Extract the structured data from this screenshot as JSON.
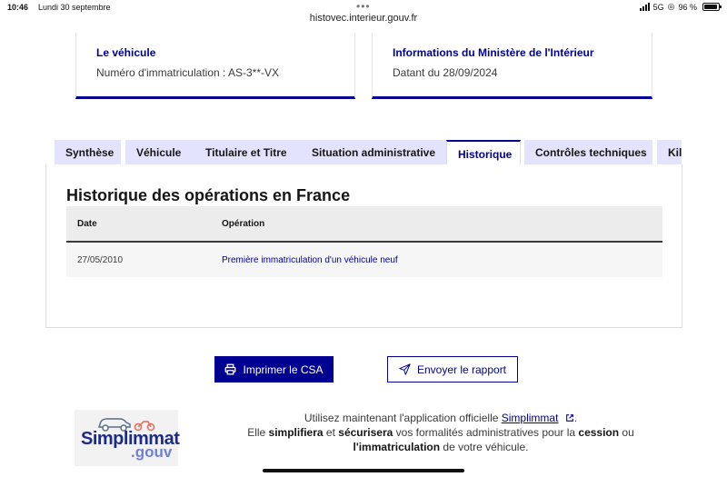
{
  "status": {
    "time": "10:46",
    "date": "Lundi 30 septembre",
    "network": "5G",
    "battery": "96 %",
    "battery_level": 0.96
  },
  "browser": {
    "url": "histovec.interieur.gouv.fr"
  },
  "cards": {
    "vehicle": {
      "title": "Le véhicule",
      "text": "Numéro d'immatriculation : AS-3**-VX"
    },
    "ministry": {
      "title": "Informations du Ministère de l'Intérieur",
      "text": "Datant du 28/09/2024"
    }
  },
  "tabs": [
    {
      "label": "Synthèse"
    },
    {
      "label": "Véhicule"
    },
    {
      "label": "Titulaire et Titre"
    },
    {
      "label": "Situation administrative"
    },
    {
      "label": "Historique"
    },
    {
      "label": "Contrôles techniques"
    },
    {
      "label": "Kilométrage"
    }
  ],
  "history": {
    "title": "Historique des opérations en France",
    "columns": [
      "Date",
      "Opération"
    ],
    "rows": [
      {
        "date": "27/05/2010",
        "operation": "Première immatriculation d'un véhicule neuf"
      }
    ]
  },
  "actions": {
    "print_label": "Imprimer le CSA",
    "send_label": "Envoyer le rapport"
  },
  "promo": {
    "logo_line1": "Simplimmat",
    "logo_line2": ".gouv",
    "l1_a": "Utilisez maintenant l'application officielle ",
    "link": "Simplimmat",
    "l1_b": ".",
    "l2_a": "Elle ",
    "l2_b1": "simplifiera",
    "l2_c": " et ",
    "l2_b2": "sécurisera",
    "l2_d": " vos formalités administratives pour la ",
    "l2_b3": "cession",
    "l2_e": " ou",
    "l3_b": "l'immatriculation",
    "l3_a": " de votre véhicule."
  }
}
